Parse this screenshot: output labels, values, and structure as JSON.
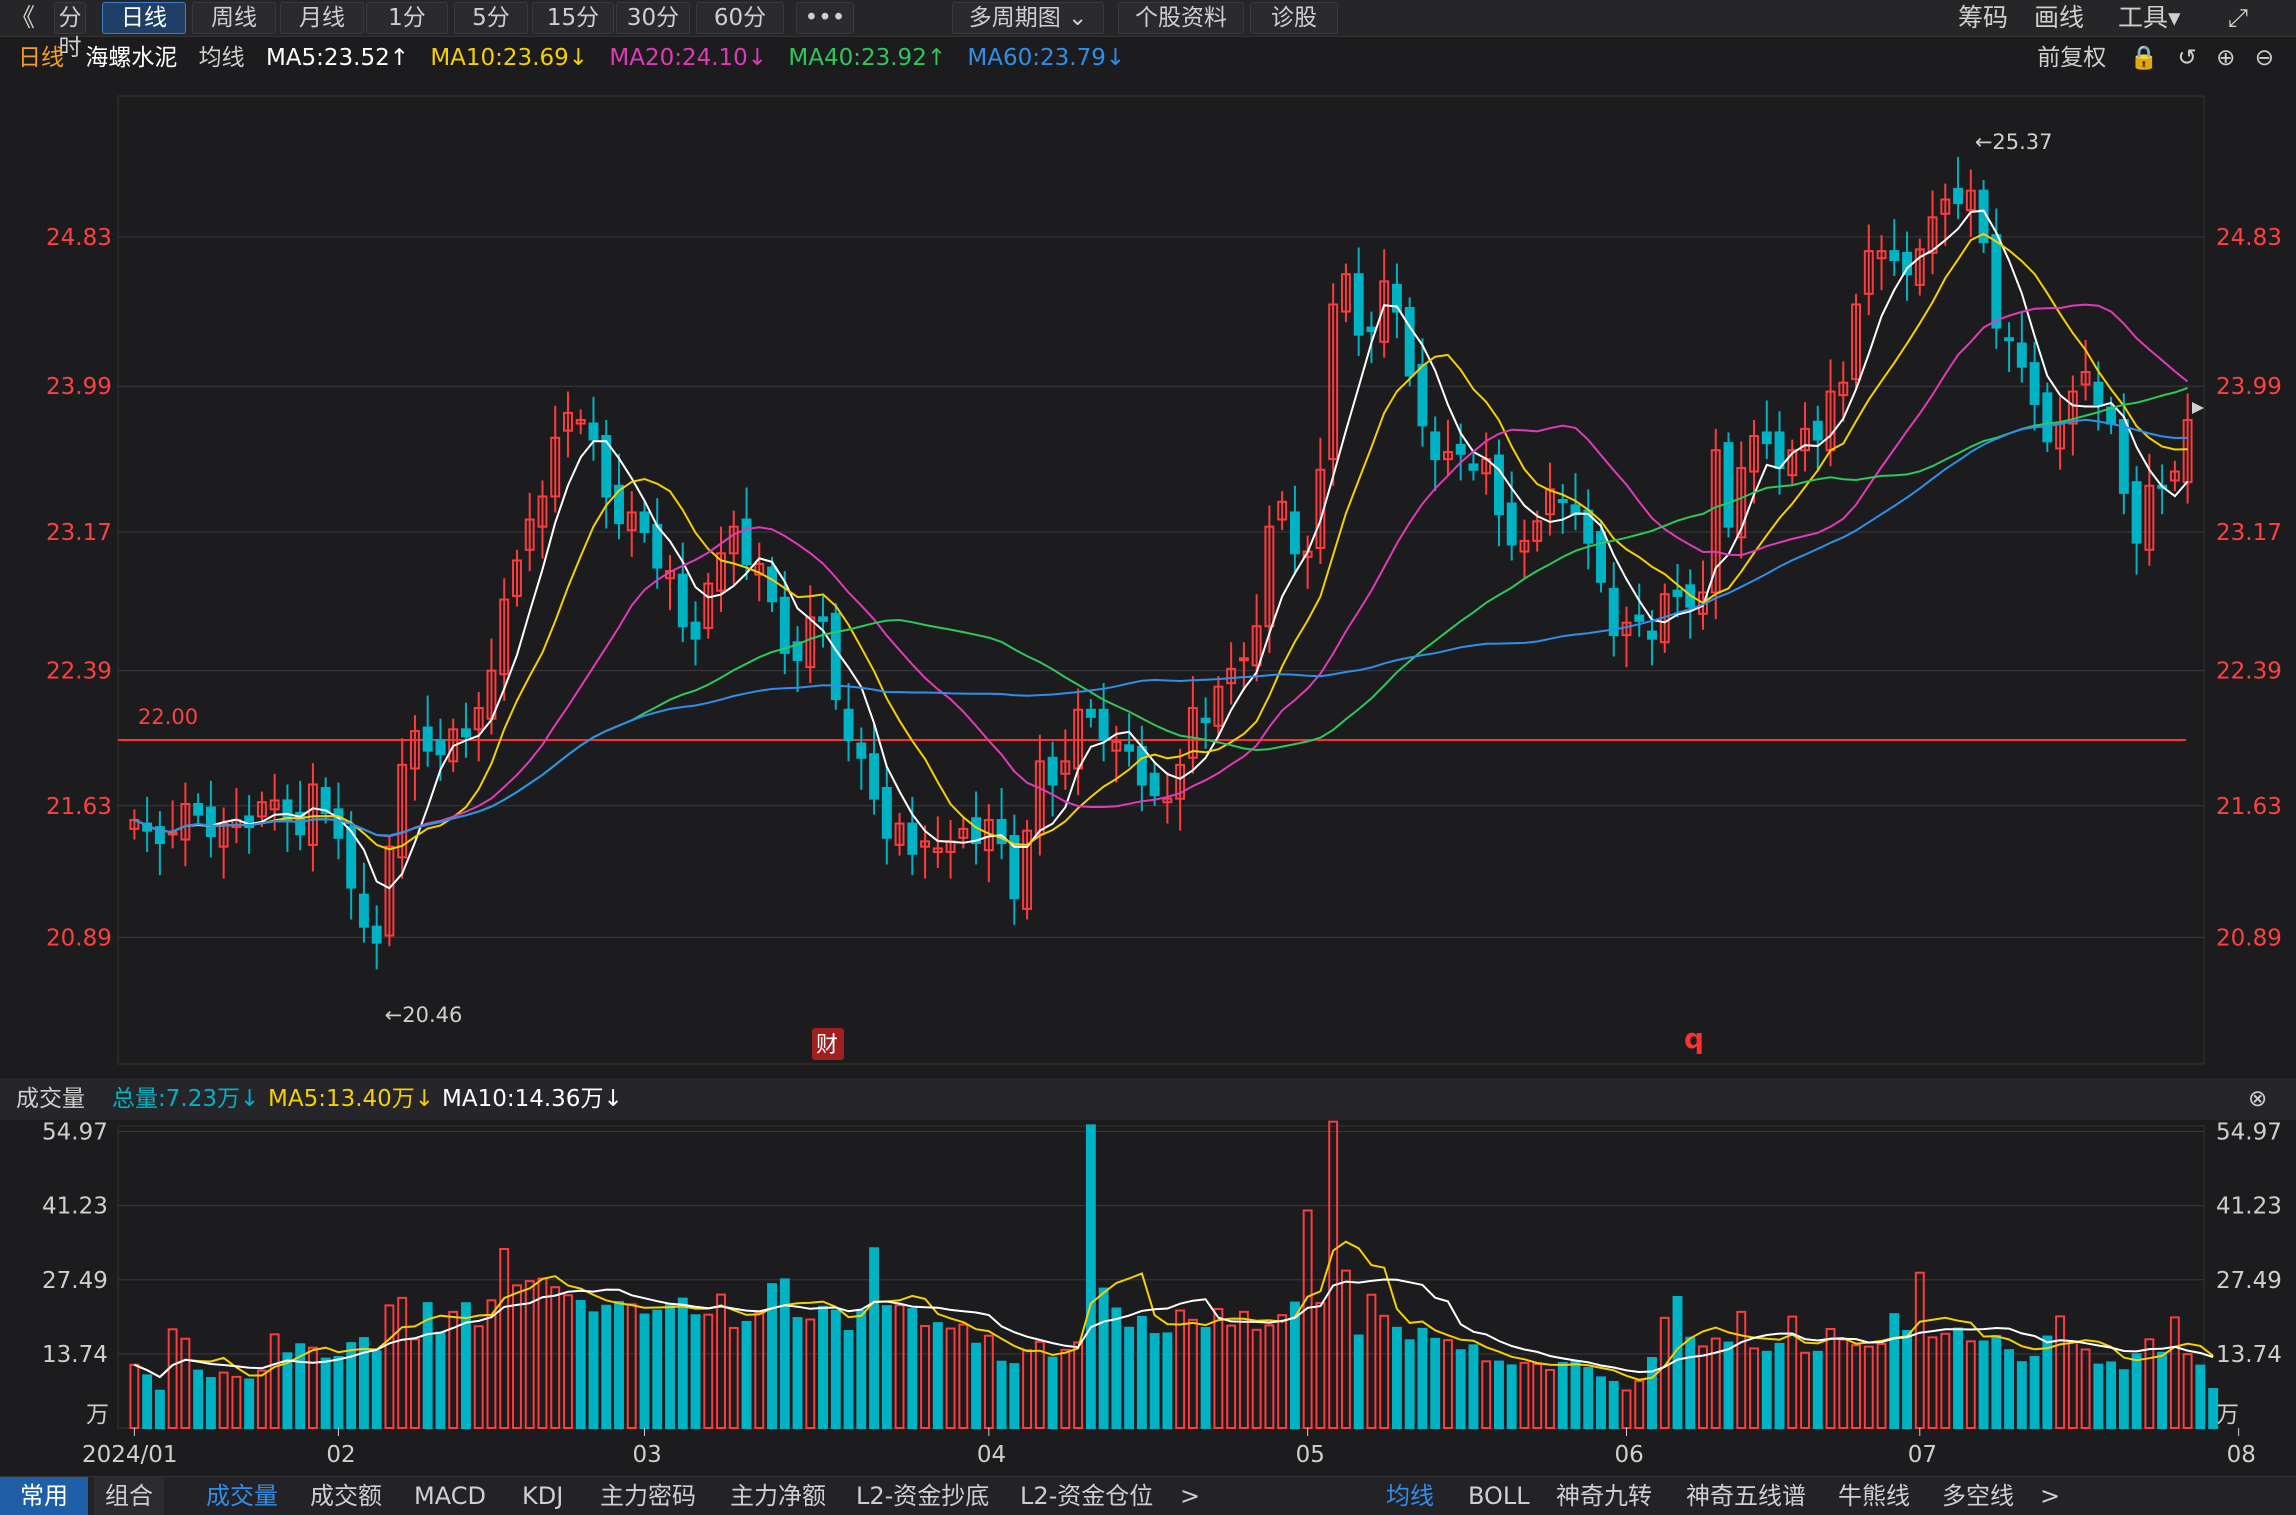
{
  "toolbar": {
    "back": "《",
    "tabs": [
      "分时",
      "日线",
      "周线",
      "月线",
      "1分",
      "5分",
      "15分",
      "30分",
      "60分",
      "•••",
      "多周期图 ⌄",
      "个股资料",
      "诊股"
    ],
    "active": "日线",
    "right": [
      "筹码",
      "画线",
      "工具▾",
      "⤢"
    ]
  },
  "ma_bar": {
    "period": "日线",
    "stock": "海螺水泥",
    "label": "均线",
    "ma5": "MA5:23.52↑",
    "ma10": "MA10:23.69↓",
    "ma20": "MA20:24.10↓",
    "ma40": "MA40:23.92↑",
    "ma60": "MA60:23.79↓",
    "adjust": "前复权"
  },
  "colors": {
    "up": "#ff3b3b",
    "down": "#00b3c4",
    "ma5": "#ffffff",
    "ma10": "#f5d000",
    "ma20": "#e03ab8",
    "ma40": "#2ec85a",
    "ma60": "#2f8fe8",
    "axis": "#ff4040"
  },
  "volume_bar": {
    "title": "成交量",
    "total": "总量:7.23万↓",
    "ma5": "MA5:13.40万↓",
    "ma10": "MA10:14.36万↓"
  },
  "bottom_left": [
    "常用",
    "组合"
  ],
  "bottom_indicators": [
    "成交量",
    "成交额",
    "MACD",
    "KDJ",
    "主力密码",
    "主力净额",
    "L2-资金抄底",
    "L2-资金仓位",
    ">"
  ],
  "bottom_right": [
    "均线",
    "BOLL",
    "神奇九转",
    "神奇五线谱",
    "牛熊线",
    "多空线",
    ">"
  ],
  "markers": {
    "fin": "财",
    "q": "q"
  },
  "chart_data": [
    {
      "type": "candlestick",
      "title": "",
      "y_ticks": [
        "24.83",
        "23.99",
        "23.17",
        "22.39",
        "21.63",
        "20.89"
      ],
      "ylim": [
        20.2,
        25.6
      ],
      "hline": {
        "value": 22.0,
        "label": "22.00"
      },
      "annotations": [
        {
          "label": "←25.37",
          "value": 25.37
        },
        {
          "label": "←20.46",
          "value": 20.46
        }
      ],
      "x_ticks": [
        "2024/01",
        "02",
        "03",
        "04",
        "05",
        "06",
        "07",
        "08"
      ],
      "closes": [
        21.55,
        21.49,
        21.42,
        21.48,
        21.64,
        21.58,
        21.46,
        21.53,
        21.55,
        21.51,
        21.65,
        21.66,
        21.55,
        21.47,
        21.75,
        21.59,
        21.45,
        21.17,
        20.95,
        20.86,
        21.4,
        21.86,
        22.05,
        21.94,
        21.92,
        22.06,
        22.02,
        22.18,
        22.39,
        22.79,
        23.01,
        23.24,
        23.37,
        23.7,
        23.84,
        23.8,
        23.69,
        23.37,
        23.22,
        23.28,
        23.17,
        22.97,
        22.95,
        22.64,
        22.57,
        22.88,
        23.05,
        23.2,
        22.99,
        22.99,
        22.78,
        22.49,
        22.45,
        22.69,
        22.67,
        22.23,
        22.0,
        21.9,
        21.67,
        21.45,
        21.53,
        21.36,
        21.43,
        21.39,
        21.43,
        21.5,
        21.42,
        21.55,
        21.42,
        21.11,
        21.49,
        21.88,
        21.75,
        21.88,
        22.17,
        22.13,
        22.0,
        21.99,
        21.94,
        21.75,
        21.69,
        21.67,
        21.86,
        22.18,
        22.1,
        22.3,
        22.4,
        22.46,
        22.64,
        23.2,
        23.34,
        23.05,
        23.06,
        23.52,
        24.45,
        24.62,
        24.28,
        24.3,
        24.58,
        24.41,
        24.05,
        23.77,
        23.58,
        23.62,
        23.61,
        23.52,
        23.58,
        23.27,
        23.1,
        23.12,
        23.23,
        23.41,
        23.34,
        23.27,
        23.11,
        22.89,
        22.59,
        22.66,
        22.67,
        22.57,
        22.82,
        22.81,
        22.75,
        22.83,
        23.63,
        23.2,
        23.53,
        23.71,
        23.67,
        23.53,
        23.63,
        23.75,
        23.69,
        23.96,
        24.01,
        24.45,
        24.75,
        24.75,
        24.7,
        24.62,
        24.76,
        24.94,
        25.04,
        25.02,
        25.09,
        24.8,
        24.32,
        24.25,
        24.1,
        23.89,
        23.68,
        23.78,
        23.96,
        24.07,
        23.89,
        23.78,
        23.39,
        23.11,
        23.43,
        23.42,
        23.51,
        23.8
      ]
    },
    {
      "type": "bar",
      "title": "",
      "y_ticks": [
        "54.97",
        "41.23",
        "27.49",
        "13.74"
      ],
      "unit": "万",
      "ylim": [
        0,
        56
      ],
      "values": [
        11.72,
        9.75,
        6.91,
        18.3,
        16.55,
        10.64,
        9.26,
        10.28,
        9.48,
        9.0,
        10.64,
        17.37,
        13.85,
        15.52,
        14.89,
        12.87,
        13.18,
        15.74,
        16.68,
        14.21,
        22.73,
        24.13,
        16.45,
        23.15,
        17.66,
        21.53,
        23.14,
        18.87,
        23.68,
        33.2,
        26.45,
        27.24,
        27.7,
        26.11,
        24.61,
        23.55,
        21.44,
        22.66,
        23.37,
        22.93,
        21.04,
        21.76,
        23.02,
        23.99,
        20.91,
        21.01,
        24.74,
        18.55,
        19.67,
        21.47,
        26.67,
        27.55,
        20.38,
        20.12,
        22.48,
        21.75,
        17.98,
        21.72,
        33.33,
        22.6,
        22.78,
        22.05,
        18.92,
        19.45,
        18.45,
        19.18,
        15.63,
        17.11,
        12.29,
        11.85,
        14.44,
        16.01,
        13.05,
        14.49,
        15.86,
        56.12,
        25.85,
        22.16,
        18.59,
        20.6,
        17.42,
        17.54,
        21.79,
        20.06,
        18.55,
        22.06,
        18.99,
        21.54,
        18.21,
        19.03,
        20.92,
        23.26,
        40.34,
        23.16,
        56.8,
        29.19,
        17.15,
        24.71,
        20.8,
        18.57,
        16.26,
        18.39,
        16.53,
        16.29,
        14.42,
        15.32,
        12.36,
        12.32,
        11.61,
        12.08,
        11.87,
        10.76,
        12.06,
        12.37,
        11.11,
        9.38,
        8.54,
        6.96,
        8.7,
        12.98,
        20.42,
        24.3,
        16.74,
        15.13,
        16.59,
        15.84,
        21.53,
        14.76,
        14.12,
        15.6,
        20.66,
        13.95,
        14.12,
        18.36,
        16.39,
        15.35,
        15.09,
        15.58,
        21.11,
        17.99,
        28.79,
        16.81,
        17.47,
        18.46,
        16.07,
        16.05,
        17.06,
        14.43,
        12.21,
        13.2,
        16.96,
        20.7,
        16.06,
        14.56,
        11.75,
        12.16,
        10.71,
        13.68,
        16.45,
        13.95,
        20.51,
        13.69,
        11.56,
        7.23
      ]
    }
  ]
}
